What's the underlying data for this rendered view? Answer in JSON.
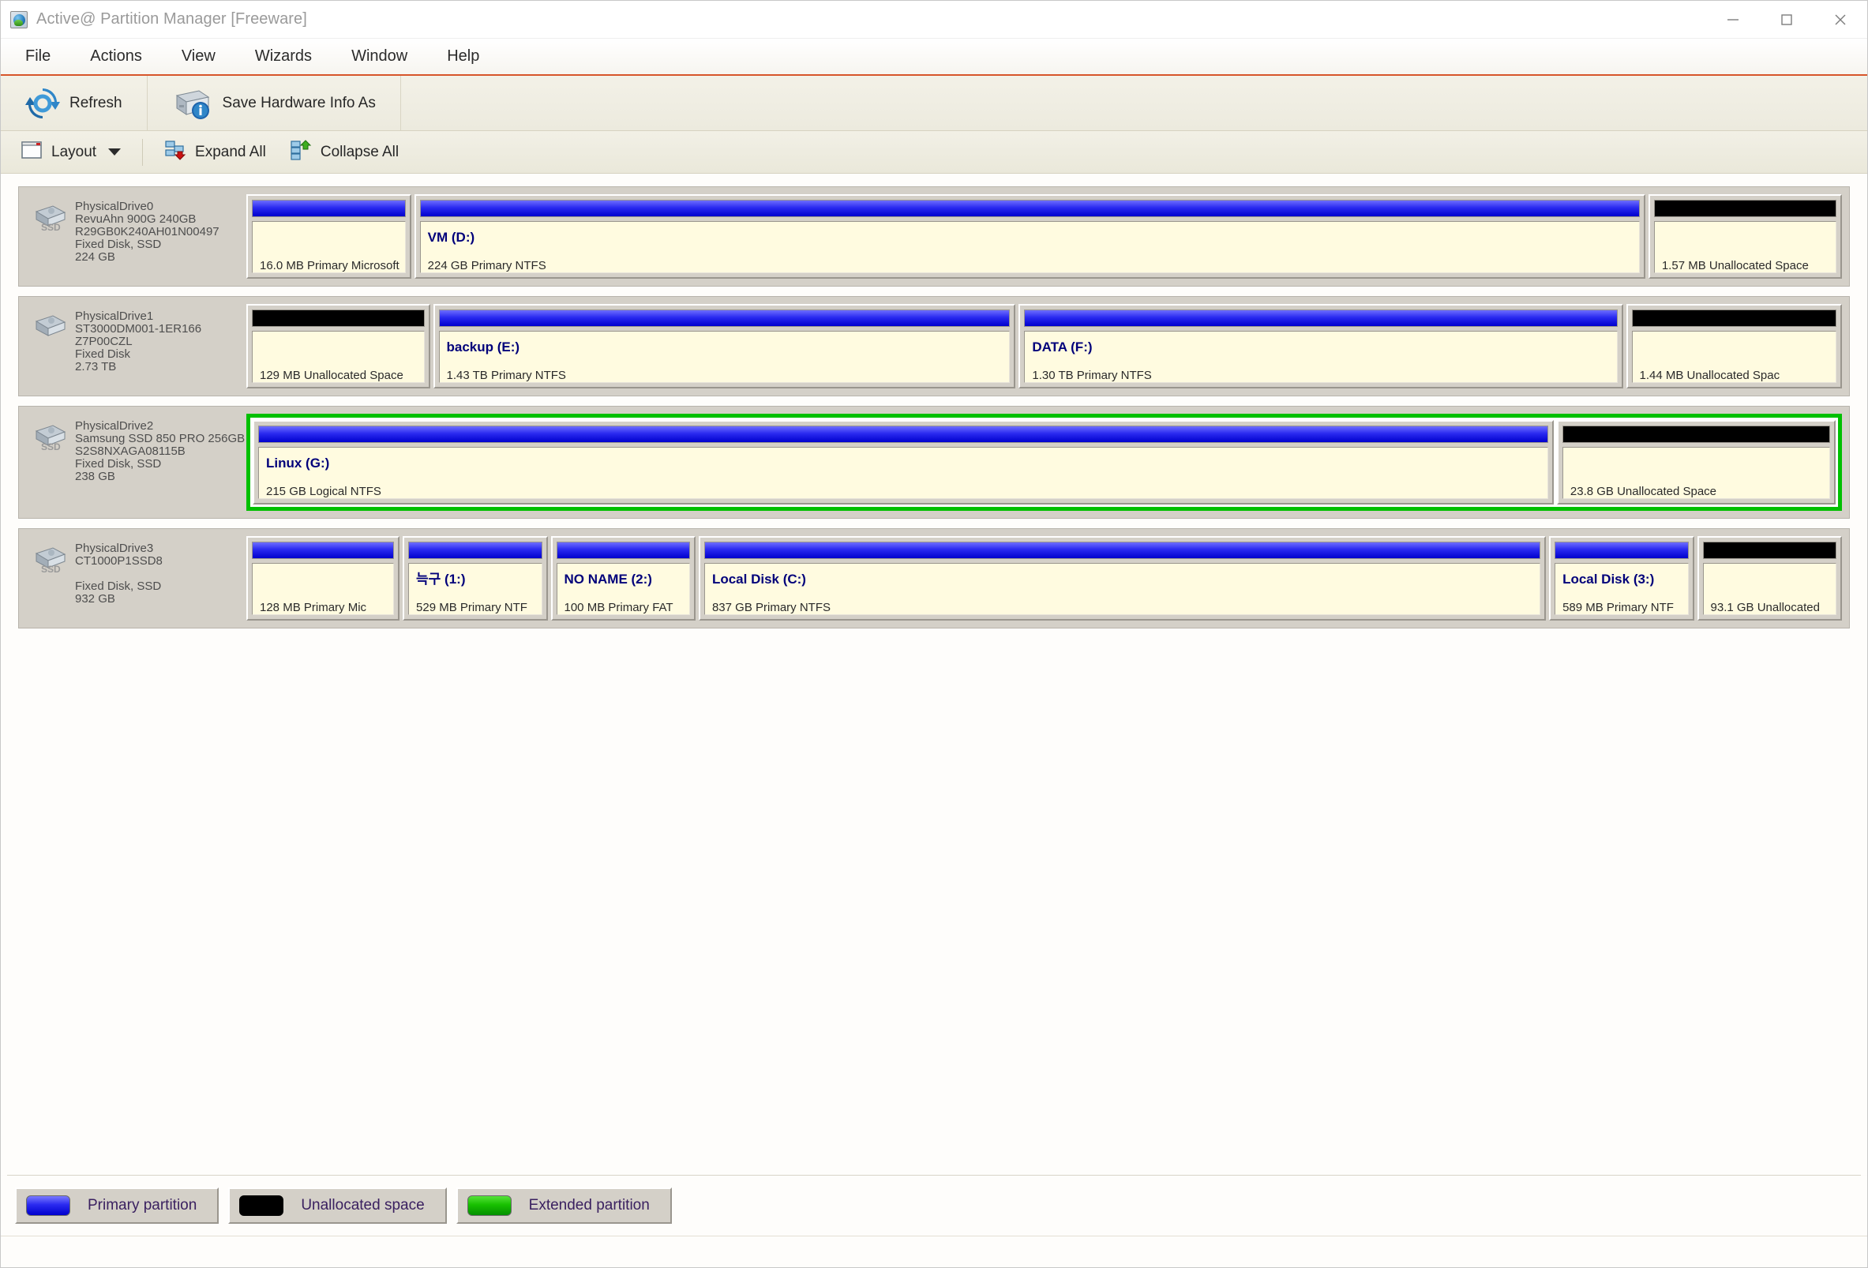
{
  "window": {
    "title": "Active@ Partition Manager [Freeware]",
    "icon": "app-icon",
    "minimize_label": "–",
    "maximize_label": "□",
    "close_label": "✕"
  },
  "menubar": {
    "items": [
      {
        "label": "File"
      },
      {
        "label": "Actions"
      },
      {
        "label": "View"
      },
      {
        "label": "Wizards"
      },
      {
        "label": "Window"
      },
      {
        "label": "Help"
      }
    ]
  },
  "toolbar_main": {
    "refresh_label": "Refresh",
    "save_hw_label": "Save Hardware Info As"
  },
  "toolbar_layout": {
    "layout_label": "Layout",
    "expand_all_label": "Expand All",
    "collapse_all_label": "Collapse All"
  },
  "disks": [
    {
      "name": "PhysicalDrive0",
      "model": "RevuAhn 900G 240GB",
      "serial": "R29GB0K240AH01N00497",
      "type": "Fixed Disk, SSD",
      "size": "224 GB",
      "is_ssd": true,
      "selected": false,
      "partitions": [
        {
          "name": "",
          "desc": "16.0 MB Primary Microsoft",
          "kind": "primary",
          "flex": 16,
          "extended": false
        },
        {
          "name": "VM (D:)",
          "desc": "224 GB Primary NTFS",
          "kind": "primary",
          "flex": 127,
          "extended": false
        },
        {
          "name": "",
          "desc": "1.57 MB Unallocated Space",
          "kind": "unallocated",
          "flex": 19,
          "extended": false
        }
      ]
    },
    {
      "name": "PhysicalDrive1",
      "model": "ST3000DM001-1ER166",
      "serial": "Z7P00CZL",
      "type": "Fixed Disk",
      "size": "2.73 TB",
      "is_ssd": false,
      "selected": false,
      "partitions": [
        {
          "name": "",
          "desc": "129 MB Unallocated Space",
          "kind": "unallocated",
          "flex": 16,
          "extended": false
        },
        {
          "name": "backup (E:)",
          "desc": "1.43 TB Primary NTFS",
          "kind": "primary",
          "flex": 53,
          "extended": false
        },
        {
          "name": "DATA (F:)",
          "desc": "1.30 TB Primary NTFS",
          "kind": "primary",
          "flex": 55,
          "extended": false
        },
        {
          "name": "",
          "desc": "1.44 MB Unallocated Spac",
          "kind": "unallocated",
          "flex": 19,
          "extended": false
        }
      ]
    },
    {
      "name": "PhysicalDrive2",
      "model": "Samsung SSD 850 PRO 256GB",
      "serial": "S2S8NXAGA08115B",
      "type": "Fixed Disk, SSD",
      "size": "238 GB",
      "is_ssd": true,
      "selected": true,
      "partitions": [
        {
          "name": "Linux  (G:)",
          "desc": "215 GB Logical NTFS",
          "kind": "primary",
          "flex": 106,
          "extended": true
        },
        {
          "name": "",
          "desc": "23.8 GB Unallocated Space",
          "kind": "unallocated",
          "flex": 22,
          "extended": true
        }
      ]
    },
    {
      "name": "PhysicalDrive3",
      "model": "CT1000P1SSD8",
      "serial": "",
      "type": "Fixed Disk, SSD",
      "size": "932 GB",
      "is_ssd": true,
      "selected": false,
      "partitions": [
        {
          "name": "",
          "desc": "128 MB Primary Mic",
          "kind": "primary",
          "flex": 17,
          "extended": false
        },
        {
          "name": "늑구 (1:)",
          "desc": "529 MB Primary NTF",
          "kind": "primary",
          "flex": 16,
          "extended": false
        },
        {
          "name": "NO NAME (2:)",
          "desc": "100 MB Primary FAT",
          "kind": "primary",
          "flex": 16,
          "extended": false
        },
        {
          "name": "Local Disk (C:)",
          "desc": "837 GB Primary NTFS",
          "kind": "primary",
          "flex": 100,
          "extended": false
        },
        {
          "name": "Local Disk (3:)",
          "desc": "589 MB Primary NTF",
          "kind": "primary",
          "flex": 16,
          "extended": false
        },
        {
          "name": "",
          "desc": "93.1 GB Unallocated",
          "kind": "unallocated",
          "flex": 16,
          "extended": false
        }
      ]
    }
  ],
  "legend": {
    "items": [
      {
        "label": "Primary partition",
        "swatch": "primary",
        "color": "#0000cd"
      },
      {
        "label": "Unallocated space",
        "swatch": "unalloc",
        "color": "#000000"
      },
      {
        "label": "Extended partition",
        "swatch": "extended",
        "color": "#18c000"
      }
    ]
  },
  "colors": {
    "accent_underline": "#d7552a",
    "selection_border": "#00c000",
    "partition_body": "#fffbe0",
    "panel": "#d4d0c8"
  }
}
